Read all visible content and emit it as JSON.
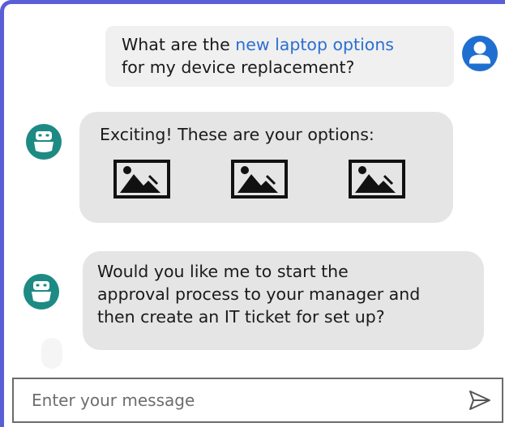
{
  "chat": {
    "messages": [
      {
        "role": "user",
        "text_before_link": "What are the ",
        "link_text": "new laptop options",
        "text_after_link": "for my device replacement?"
      },
      {
        "role": "bot",
        "text": "Exciting! These are your options:",
        "attachments": [
          {
            "icon": "image-placeholder-icon"
          },
          {
            "icon": "image-placeholder-icon"
          },
          {
            "icon": "image-placeholder-icon"
          }
        ]
      },
      {
        "role": "bot",
        "lines": [
          "Would you like me to start the",
          "approval process to your manager and",
          "then create an IT ticket for set up?"
        ]
      }
    ]
  },
  "composer": {
    "placeholder": "Enter your message",
    "send_icon": "send-icon"
  },
  "colors": {
    "accent_border": "#5b5fd6",
    "link": "#2b6fd1",
    "user_avatar": "#1f6fd0",
    "bot_avatar": "#1e8a84",
    "user_bubble": "#f0f0f0",
    "bot_bubble": "#e5e5e5"
  }
}
